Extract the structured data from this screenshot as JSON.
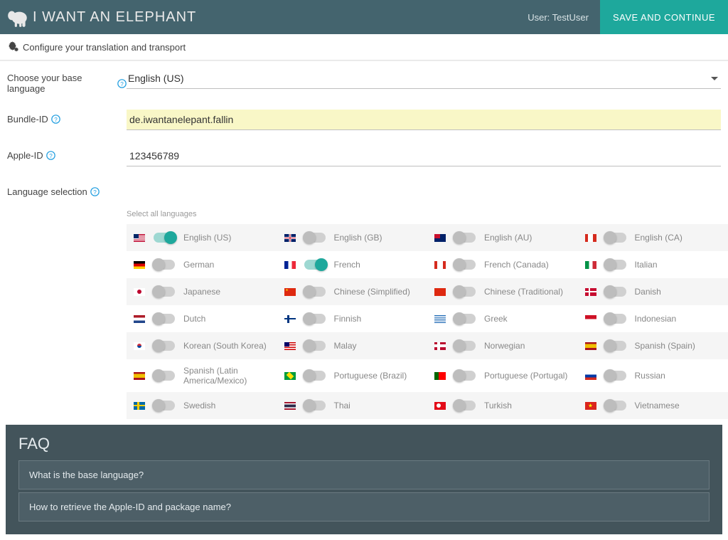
{
  "header": {
    "brand": "I WANT AN ELEPHANT",
    "user_prefix": "User: ",
    "user_name": "TestUser",
    "save_button": "SAVE AND CONTINUE"
  },
  "subtitle": "Configure your translation and transport",
  "form": {
    "base_language_label": "Choose your base language",
    "base_language_value": "English (US)",
    "bundle_label": "Bundle-ID",
    "bundle_value": "de.iwantanelepant.fallin",
    "apple_label": "Apple-ID",
    "apple_value": "123456789",
    "lang_selection_label": "Language selection",
    "select_all": "Select all languages"
  },
  "languages": [
    {
      "name": "English (US)",
      "flag": "fl-us",
      "on": true
    },
    {
      "name": "English (GB)",
      "flag": "fl-gb",
      "on": false
    },
    {
      "name": "English (AU)",
      "flag": "fl-au",
      "on": false
    },
    {
      "name": "English (CA)",
      "flag": "fl-ca",
      "on": false
    },
    {
      "name": "German",
      "flag": "fl-de",
      "on": false
    },
    {
      "name": "French",
      "flag": "fl-fr",
      "on": true
    },
    {
      "name": "French (Canada)",
      "flag": "fl-cafr",
      "on": false
    },
    {
      "name": "Italian",
      "flag": "fl-it",
      "on": false
    },
    {
      "name": "Japanese",
      "flag": "fl-jp",
      "on": false
    },
    {
      "name": "Chinese (Simplified)",
      "flag": "fl-cn",
      "on": false
    },
    {
      "name": "Chinese (Traditional)",
      "flag": "fl-cnt",
      "on": false
    },
    {
      "name": "Danish",
      "flag": "fl-dk",
      "on": false
    },
    {
      "name": "Dutch",
      "flag": "fl-nl",
      "on": false
    },
    {
      "name": "Finnish",
      "flag": "fl-fi",
      "on": false
    },
    {
      "name": "Greek",
      "flag": "fl-gr",
      "on": false
    },
    {
      "name": "Indonesian",
      "flag": "fl-id",
      "on": false
    },
    {
      "name": "Korean (South Korea)",
      "flag": "fl-kr",
      "on": false
    },
    {
      "name": "Malay",
      "flag": "fl-my",
      "on": false
    },
    {
      "name": "Norwegian",
      "flag": "fl-no",
      "on": false
    },
    {
      "name": "Spanish (Spain)",
      "flag": "fl-es",
      "on": false
    },
    {
      "name": "Spanish (Latin America/Mexico)",
      "flag": "fl-es",
      "on": false
    },
    {
      "name": "Portuguese (Brazil)",
      "flag": "fl-br",
      "on": false
    },
    {
      "name": "Portuguese (Portugal)",
      "flag": "fl-pt",
      "on": false
    },
    {
      "name": "Russian",
      "flag": "fl-ru",
      "on": false
    },
    {
      "name": "Swedish",
      "flag": "fl-se",
      "on": false
    },
    {
      "name": "Thai",
      "flag": "fl-th",
      "on": false
    },
    {
      "name": "Turkish",
      "flag": "fl-tr",
      "on": false
    },
    {
      "name": "Vietnamese",
      "flag": "fl-vn",
      "on": false
    }
  ],
  "faq": {
    "title": "FAQ",
    "items": [
      "What is the base language?",
      "How to retrieve the Apple-ID and package name?"
    ]
  }
}
